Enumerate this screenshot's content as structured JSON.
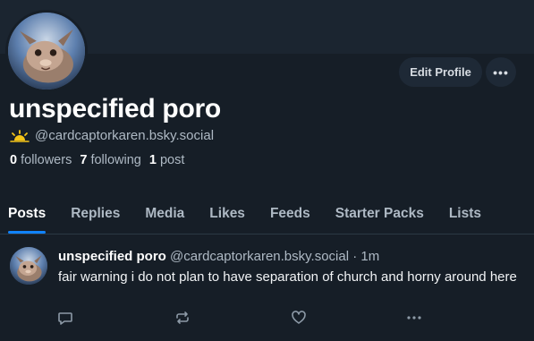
{
  "profile": {
    "display_name": "unspecified poro",
    "handle": "@cardcaptorkaren.bsky.social",
    "badge_icon": "sun-icon",
    "stats": {
      "followers_count": "0",
      "followers_label": "followers",
      "following_count": "7",
      "following_label": "following",
      "posts_count": "1",
      "posts_label": "post"
    }
  },
  "buttons": {
    "edit_profile": "Edit Profile",
    "more": "•••"
  },
  "tabs": [
    {
      "label": "Posts",
      "active": true
    },
    {
      "label": "Replies"
    },
    {
      "label": "Media"
    },
    {
      "label": "Likes"
    },
    {
      "label": "Feeds"
    },
    {
      "label": "Starter Packs"
    },
    {
      "label": "Lists"
    }
  ],
  "post": {
    "author_name": "unspecified poro",
    "author_handle": "@cardcaptorkaren.bsky.social",
    "time": "· 1m",
    "text": "fair warning i do not plan to have separation of church and horny around here",
    "actions": [
      "reply-icon",
      "repost-icon",
      "like-icon",
      "more-icon"
    ]
  },
  "colors": {
    "background": "#161e27",
    "accent": "#1083fe",
    "muted": "#aeb9c4",
    "badge": "#f5c518"
  }
}
